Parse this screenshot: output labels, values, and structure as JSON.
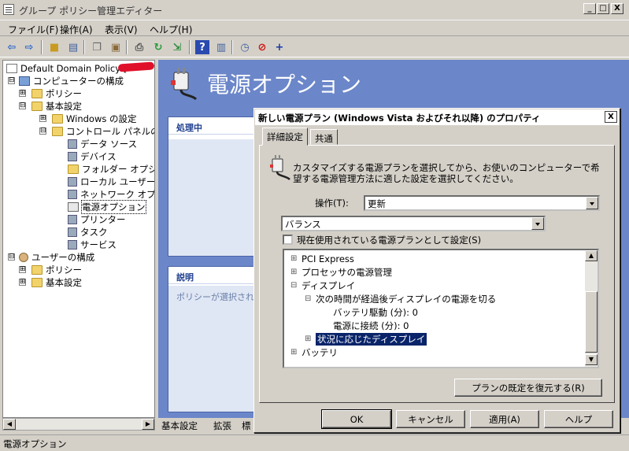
{
  "window": {
    "title": "グループ ポリシー管理エディター",
    "controls": [
      "_",
      "□",
      "X"
    ]
  },
  "menu": [
    "ファイル(F)",
    "操作(A)",
    "表示(V)",
    "ヘルプ(H)"
  ],
  "toolbar_icons": [
    "back-arrow-icon",
    "forward-arrow-icon",
    "up-folder-icon",
    "show-tree-icon",
    "copy-icon",
    "paste-icon",
    "print-icon",
    "refresh-icon",
    "export-icon",
    "help-icon",
    "properties-icon",
    "new-icon",
    "delete-icon",
    "add-icon"
  ],
  "tree": {
    "root": "Default Domain Policy [",
    "items": [
      {
        "label": "コンピューターの構成",
        "icon": "computer-icon",
        "expander": "⊟"
      },
      {
        "label": "ポリシー",
        "icon": "folder-icon",
        "expander": "⊞"
      },
      {
        "label": "基本設定",
        "icon": "folder-icon",
        "expander": "⊟"
      },
      {
        "label": "Windows の設定",
        "icon": "folder-icon",
        "expander": "⊞"
      },
      {
        "label": "コントロール パネルの設",
        "icon": "control-panel-icon",
        "expander": "⊟"
      },
      {
        "label": "データ ソース",
        "icon": "data-source-icon",
        "expander": ""
      },
      {
        "label": "デバイス",
        "icon": "device-icon",
        "expander": ""
      },
      {
        "label": "フォルダー オプション",
        "icon": "folder-options-icon",
        "expander": ""
      },
      {
        "label": "ローカル ユーザーと",
        "icon": "local-users-icon",
        "expander": ""
      },
      {
        "label": "ネットワーク オプショ",
        "icon": "network-icon",
        "expander": ""
      },
      {
        "label": "電源オプション",
        "icon": "power-options-icon",
        "expander": "",
        "selected": true
      },
      {
        "label": "プリンター",
        "icon": "printer-icon",
        "expander": ""
      },
      {
        "label": "タスク",
        "icon": "task-icon",
        "expander": ""
      },
      {
        "label": "サービス",
        "icon": "services-icon",
        "expander": ""
      },
      {
        "label": "ユーザーの構成",
        "icon": "user-icon",
        "expander": "⊟"
      },
      {
        "label": "ポリシー",
        "icon": "folder-icon",
        "expander": "⊞"
      },
      {
        "label": "基本設定",
        "icon": "folder-icon",
        "expander": "⊞"
      }
    ]
  },
  "content": {
    "title": "電源オプション",
    "processing_header": "処理中",
    "description_header": "説明",
    "description_text": "ポリシーが選択されて"
  },
  "bottom_tabs": [
    "基本設定",
    "拡張",
    "標"
  ],
  "status_text": "電源オプション",
  "dialog": {
    "title": "新しい電源プラン (Windows Vista およびそれ以降) のプロパティ",
    "close": "X",
    "tabs": [
      "詳細設定",
      "共通"
    ],
    "description": "カスタマイズする電源プランを選択してから、お使いのコンピューターで希望する電源管理方法に適した設定を選択してください。",
    "action_label": "操作(T):",
    "action_value": "更新",
    "plan_value": "バランス",
    "set_active_label": "現在使用されている電源プランとして設定(S)",
    "settings_tree": [
      {
        "expander": "⊞",
        "label": "PCI Express"
      },
      {
        "expander": "⊞",
        "label": "プロセッサの電源管理"
      },
      {
        "expander": "⊟",
        "label": "ディスプレイ"
      },
      {
        "expander": "⊟",
        "label": "次の時間が経過後ディスプレイの電源を切る"
      },
      {
        "expander": "",
        "label": "バッテリ駆動 (分): 0"
      },
      {
        "expander": "",
        "label": "電源に接続 (分): 0"
      },
      {
        "expander": "⊞",
        "label": "状況に応じたディスプレイ",
        "highlighted": true
      },
      {
        "expander": "⊞",
        "label": "バッテリ"
      }
    ],
    "restore_button": "プランの既定を復元する(R)",
    "buttons": {
      "ok": "OK",
      "cancel": "キャンセル",
      "apply": "適用(A)",
      "help": "ヘルプ"
    }
  }
}
